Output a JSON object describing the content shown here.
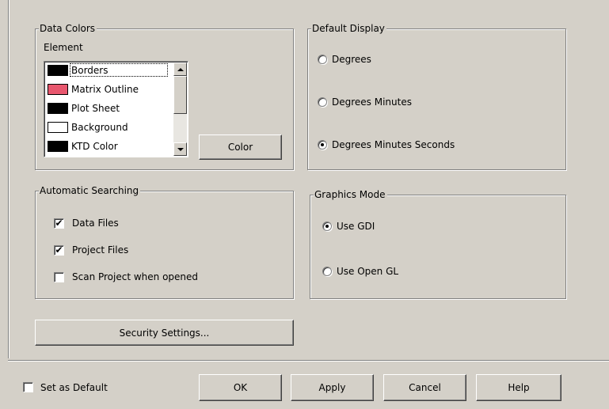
{
  "data_colors": {
    "group_title": "Data Colors",
    "element_label": "Element",
    "items": [
      {
        "label": "Borders",
        "color": "#000000"
      },
      {
        "label": "Matrix Outline",
        "color": "#e8576e"
      },
      {
        "label": "Plot Sheet",
        "color": "#000000"
      },
      {
        "label": "Background",
        "color": "#ffffff"
      },
      {
        "label": "KTD Color",
        "color": "#000000"
      }
    ],
    "color_button": "Color"
  },
  "default_display": {
    "group_title": "Default Display",
    "options": [
      {
        "label": "Degrees",
        "selected": false
      },
      {
        "label": "Degrees Minutes",
        "selected": false
      },
      {
        "label": "Degrees Minutes Seconds",
        "selected": true
      }
    ]
  },
  "automatic_searching": {
    "group_title": "Automatic Searching",
    "options": [
      {
        "label": "Data Files",
        "checked": true
      },
      {
        "label": "Project Files",
        "checked": true
      },
      {
        "label": "Scan Project when opened",
        "checked": false
      }
    ]
  },
  "graphics_mode": {
    "group_title": "Graphics Mode",
    "options": [
      {
        "label": "Use GDI",
        "selected": true
      },
      {
        "label": "Use Open GL",
        "selected": false
      }
    ]
  },
  "security_button": "Security Settings...",
  "footer": {
    "set_default_label": "Set as Default",
    "set_default_checked": false,
    "ok": "OK",
    "apply": "Apply",
    "cancel": "Cancel",
    "help": "Help"
  }
}
